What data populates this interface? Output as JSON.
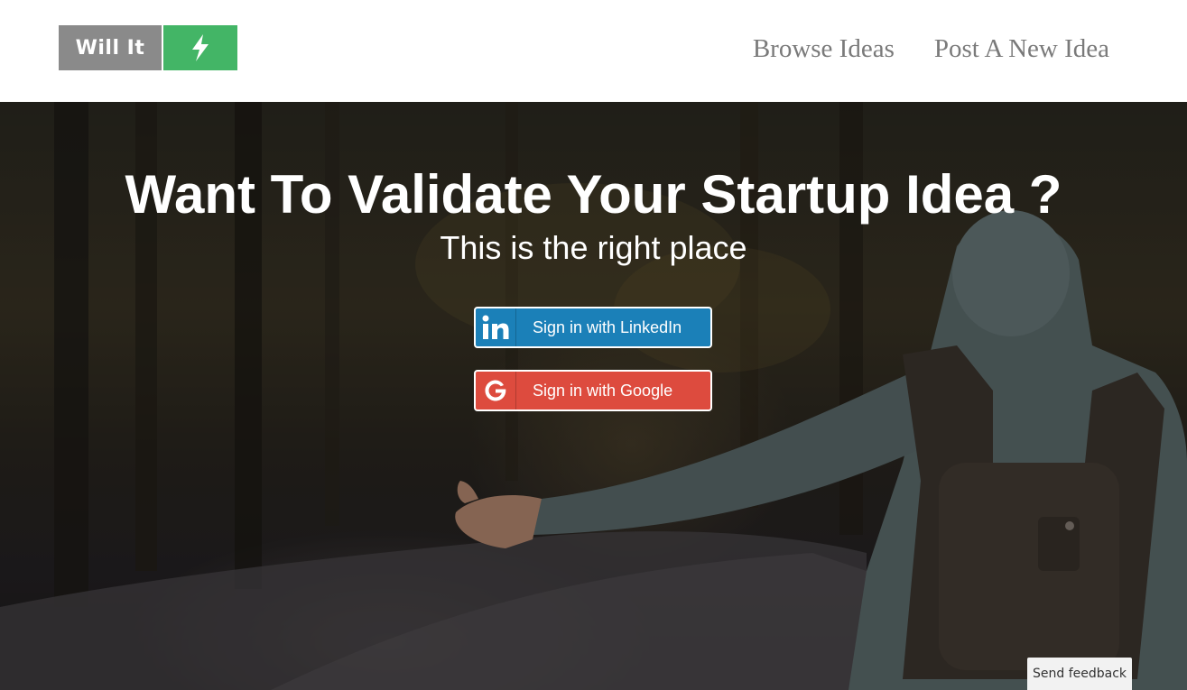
{
  "header": {
    "logo": {
      "text": "Will It",
      "icon": "lightning-bolt-icon"
    },
    "nav": [
      {
        "label": "Browse Ideas"
      },
      {
        "label": "Post A New Idea"
      }
    ]
  },
  "hero": {
    "title": "Want To Validate Your Startup Idea ?",
    "subtitle": "This is the right place",
    "buttons": {
      "linkedin": {
        "label": "Sign in with LinkedIn",
        "icon": "linkedin-icon"
      },
      "google": {
        "label": "Sign in with Google",
        "icon": "google-icon"
      }
    }
  },
  "feedback": {
    "label": "Send feedback"
  },
  "colors": {
    "logo_gray": "#8a8a8a",
    "logo_green": "#43b566",
    "linkedin_blue": "#1b80b8",
    "google_red": "#dd4b3e",
    "nav_text": "#7a7a7a"
  }
}
